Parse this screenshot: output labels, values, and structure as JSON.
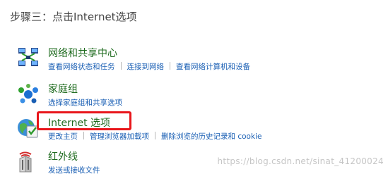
{
  "step_title": "步骤三：点击Internet选项",
  "categories": [
    {
      "title": "网络和共享中心",
      "icon": "network-sharing-icon",
      "links": [
        "查看网络状态和任务",
        "连接到网络",
        "查看网络计算机和设备"
      ]
    },
    {
      "title": "家庭组",
      "icon": "homegroup-icon",
      "links": [
        "选择家庭组和共享选项"
      ]
    },
    {
      "title": "Internet 选项",
      "icon": "internet-options-icon",
      "links": [
        "更改主页",
        "管理浏览器加载项",
        "删除浏览的历史记录和 cookie"
      ]
    },
    {
      "title": "红外线",
      "icon": "infrared-icon",
      "links": [
        "发送或接收文件"
      ]
    }
  ],
  "watermark": "https://blog.csdn.net/sinat_41200024",
  "colors": {
    "title_green": "#1e6b1e",
    "link_blue": "#1a5fb4",
    "highlight_red": "#e8161b"
  }
}
